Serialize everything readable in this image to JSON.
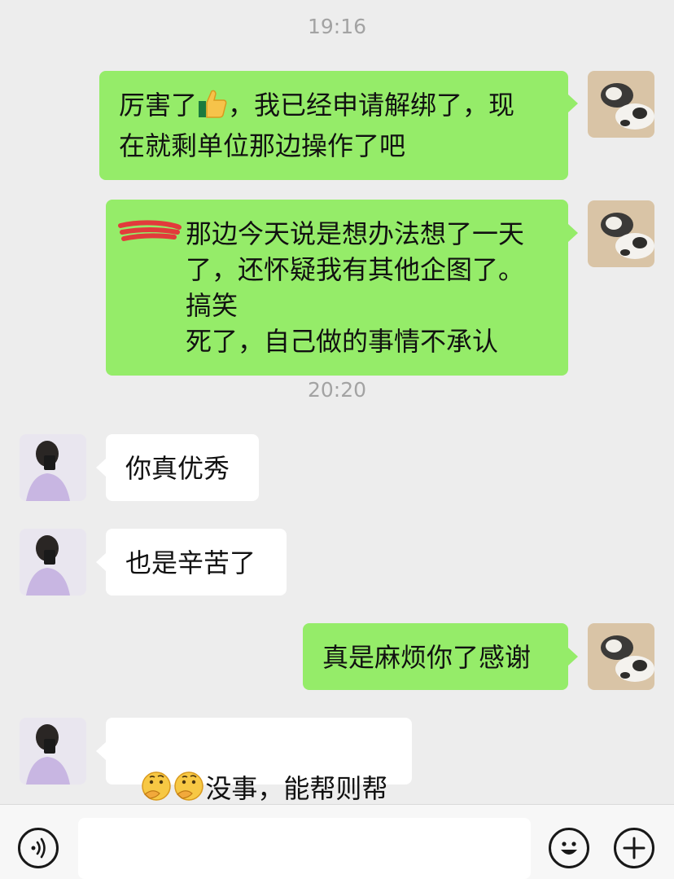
{
  "timestamps": [
    "19:16",
    "20:20"
  ],
  "messages": [
    {
      "side": "right",
      "text": "厉害了👍，我已经申请解绑了，现\n在就剩单位那边操作了吧",
      "before_emoji": "厉害了",
      "emoji": "thumbs-up-icon",
      "after_emoji": "，我已经申请解绑了，现\n在就剩单位那边操作了吧"
    },
    {
      "side": "right",
      "text": "那边今天说是想办法想了一天\n了，还怀疑我有其他企图了。搞笑\n死了，自己做的事情不承认",
      "redacted": true
    },
    {
      "side": "left",
      "text": "你真优秀"
    },
    {
      "side": "left",
      "text": "也是辛苦了"
    },
    {
      "side": "right",
      "text": "真是麻烦你了感谢"
    },
    {
      "side": "left",
      "text": "没事，能帮则帮",
      "emoji": "thinking-face-icon"
    }
  ],
  "input": {
    "placeholder": ""
  },
  "colors": {
    "bg": "#ededed",
    "my_bubble": "#95ec69",
    "their_bubble": "#ffffff",
    "timestamp": "#a3a3a3"
  },
  "icons": [
    "voice-icon",
    "emoji-icon",
    "plus-icon"
  ]
}
